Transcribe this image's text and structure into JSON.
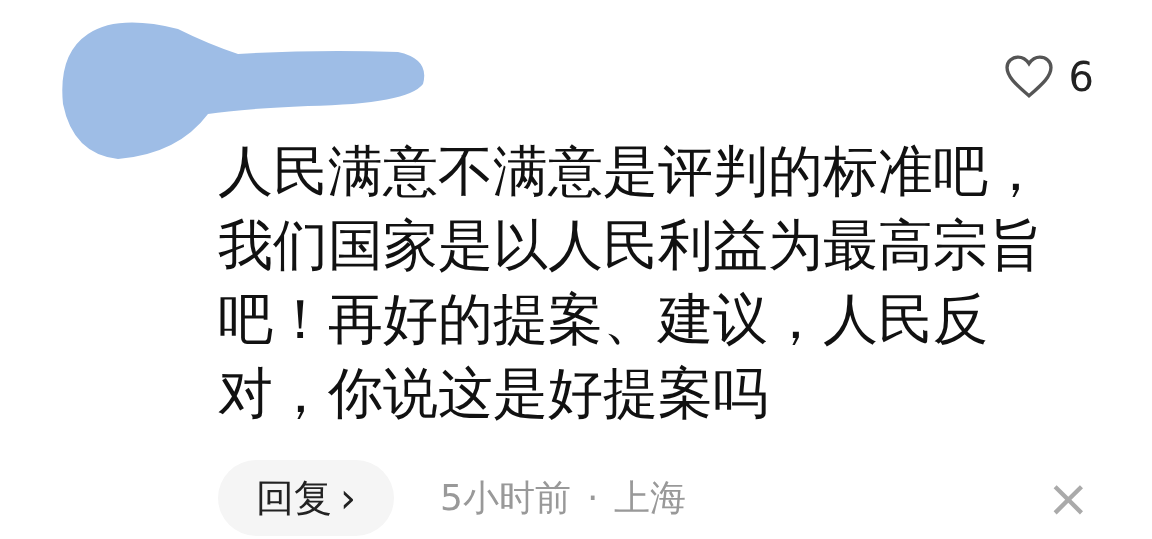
{
  "comment": {
    "likes": "6",
    "liked": false,
    "text": "人民满意不满意是评判的标准吧，我们国家是以人民利益为最高宗旨吧！再好的提案、建议，人民反对，你说这是好提案吗",
    "reply_button": "回复",
    "reply_caret": "›",
    "time": "5小时前",
    "separator": "·",
    "location": "上海",
    "close": "×"
  }
}
